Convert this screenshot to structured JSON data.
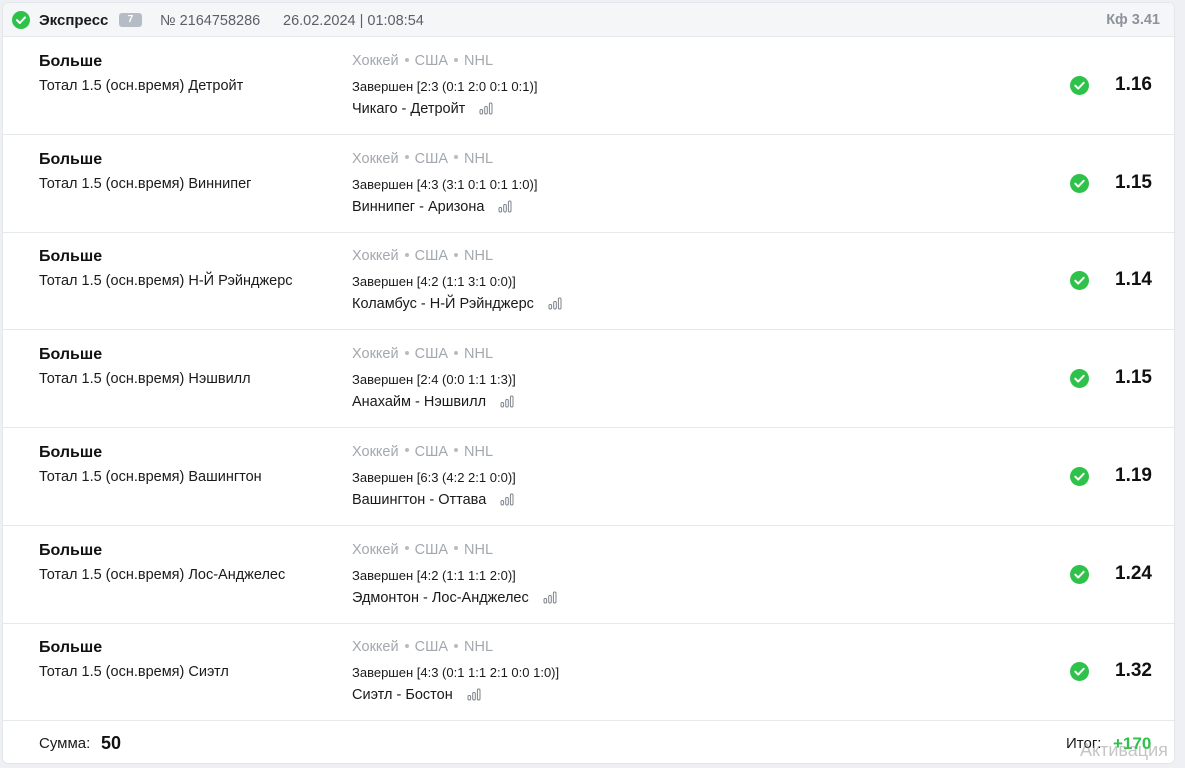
{
  "header": {
    "type": "Экспресс",
    "count": "7",
    "number": "№ 2164758286",
    "date": "26.02.2024 | 01:08:54",
    "kf": "Кф 3.41"
  },
  "bets": [
    {
      "type": "Больше",
      "desc": "Тотал 1.5 (осн.время) Детройт",
      "sport": "Хоккей",
      "country": "США",
      "league": "NHL",
      "status": "Завершен [2:3 (0:1 2:0 0:1 0:1)]",
      "match": "Чикаго - Детройт",
      "odds": "1.16"
    },
    {
      "type": "Больше",
      "desc": "Тотал 1.5 (осн.время) Виннипег",
      "sport": "Хоккей",
      "country": "США",
      "league": "NHL",
      "status": "Завершен [4:3 (3:1 0:1 0:1 1:0)]",
      "match": "Виннипег - Аризона",
      "odds": "1.15"
    },
    {
      "type": "Больше",
      "desc": "Тотал 1.5 (осн.время) Н-Й Рэйнджерс",
      "sport": "Хоккей",
      "country": "США",
      "league": "NHL",
      "status": "Завершен [4:2 (1:1 3:1 0:0)]",
      "match": "Коламбус - Н-Й Рэйнджерс",
      "odds": "1.14"
    },
    {
      "type": "Больше",
      "desc": "Тотал 1.5 (осн.время) Нэшвилл",
      "sport": "Хоккей",
      "country": "США",
      "league": "NHL",
      "status": "Завершен [2:4 (0:0 1:1 1:3)]",
      "match": "Анахайм - Нэшвилл",
      "odds": "1.15"
    },
    {
      "type": "Больше",
      "desc": "Тотал 1.5 (осн.время) Вашингтон",
      "sport": "Хоккей",
      "country": "США",
      "league": "NHL",
      "status": "Завершен [6:3 (4:2 2:1 0:0)]",
      "match": "Вашингтон - Оттава",
      "odds": "1.19"
    },
    {
      "type": "Больше",
      "desc": "Тотал 1.5 (осн.время) Лос-Анджелес",
      "sport": "Хоккей",
      "country": "США",
      "league": "NHL",
      "status": "Завершен [4:2 (1:1 1:1 2:0)]",
      "match": "Эдмонтон - Лос-Анджелес",
      "odds": "1.24"
    },
    {
      "type": "Больше",
      "desc": "Тотал 1.5 (осн.время) Сиэтл",
      "sport": "Хоккей",
      "country": "США",
      "league": "NHL",
      "status": "Завершен [4:3 (0:1 1:1 2:1 0:0 1:0)]",
      "match": "Сиэтл - Бостон",
      "odds": "1.32"
    }
  ],
  "footer": {
    "sum_label": "Сумма:",
    "sum_value": "50",
    "total_label": "Итог:",
    "total_value": "+170"
  },
  "watermark": "Активация",
  "colors": {
    "success": "#2fc24b",
    "muted": "#a3a8ae"
  }
}
